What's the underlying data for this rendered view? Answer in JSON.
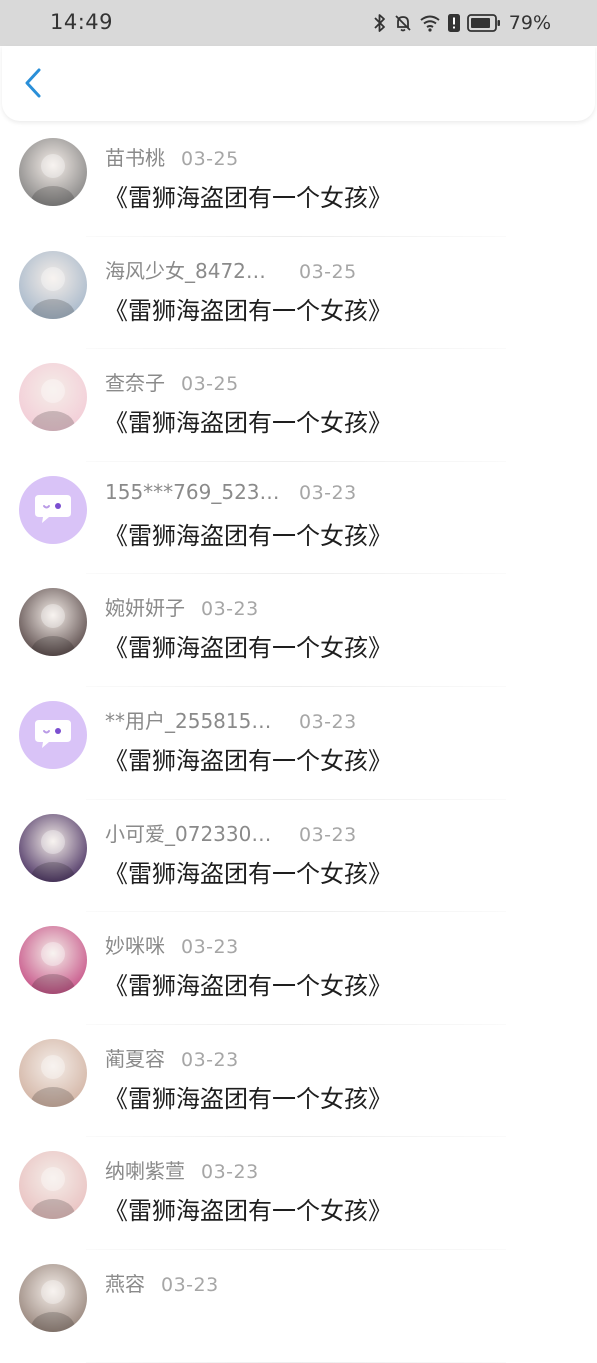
{
  "status_bar": {
    "time": "14:49",
    "battery": "79%",
    "icons": [
      "bluetooth-icon",
      "mute-icon",
      "wifi-icon",
      "alert-icon",
      "battery-icon"
    ]
  },
  "nav": {
    "back_icon": "chevron-left-icon",
    "accent": "#2a8fd8"
  },
  "list": {
    "items": [
      {
        "name": "苗书桃",
        "date": "03-25",
        "title": "《雷狮海盗团有一个女孩》",
        "avatar": "photo",
        "color": "#7a7a7a"
      },
      {
        "name": "海风少女_8472…",
        "date": "03-25",
        "title": "《雷狮海盗团有一个女孩》",
        "avatar": "photo",
        "color": "#9fb3c8"
      },
      {
        "name": "查奈子",
        "date": "03-25",
        "title": "《雷狮海盗团有一个女孩》",
        "avatar": "photo",
        "color": "#f3c9d5"
      },
      {
        "name": "155***769_523…",
        "date": "03-23",
        "title": "《雷狮海盗团有一个女孩》",
        "avatar": "default",
        "color": "#d9c3f7"
      },
      {
        "name": "婉妍妍子",
        "date": "03-23",
        "title": "《雷狮海盗团有一个女孩》",
        "avatar": "photo",
        "color": "#4a3a3a"
      },
      {
        "name": "**用户_255815…",
        "date": "03-23",
        "title": "《雷狮海盗团有一个女孩》",
        "avatar": "default",
        "color": "#d9c3f7"
      },
      {
        "name": "小可爱_072330…",
        "date": "03-23",
        "title": "《雷狮海盗团有一个女孩》",
        "avatar": "photo",
        "color": "#3b2157"
      },
      {
        "name": "妙咪咪",
        "date": "03-23",
        "title": "《雷狮海盗团有一个女孩》",
        "avatar": "photo",
        "color": "#c2427d"
      },
      {
        "name": "蔺夏容",
        "date": "03-23",
        "title": "《雷狮海盗团有一个女孩》",
        "avatar": "photo",
        "color": "#cfae9d"
      },
      {
        "name": "纳喇紫萱",
        "date": "03-23",
        "title": "《雷狮海盗团有一个女孩》",
        "avatar": "photo",
        "color": "#e8bdbd"
      },
      {
        "name": "燕容",
        "date": "03-23",
        "title": "",
        "avatar": "photo",
        "color": "#8d7a70"
      }
    ]
  }
}
